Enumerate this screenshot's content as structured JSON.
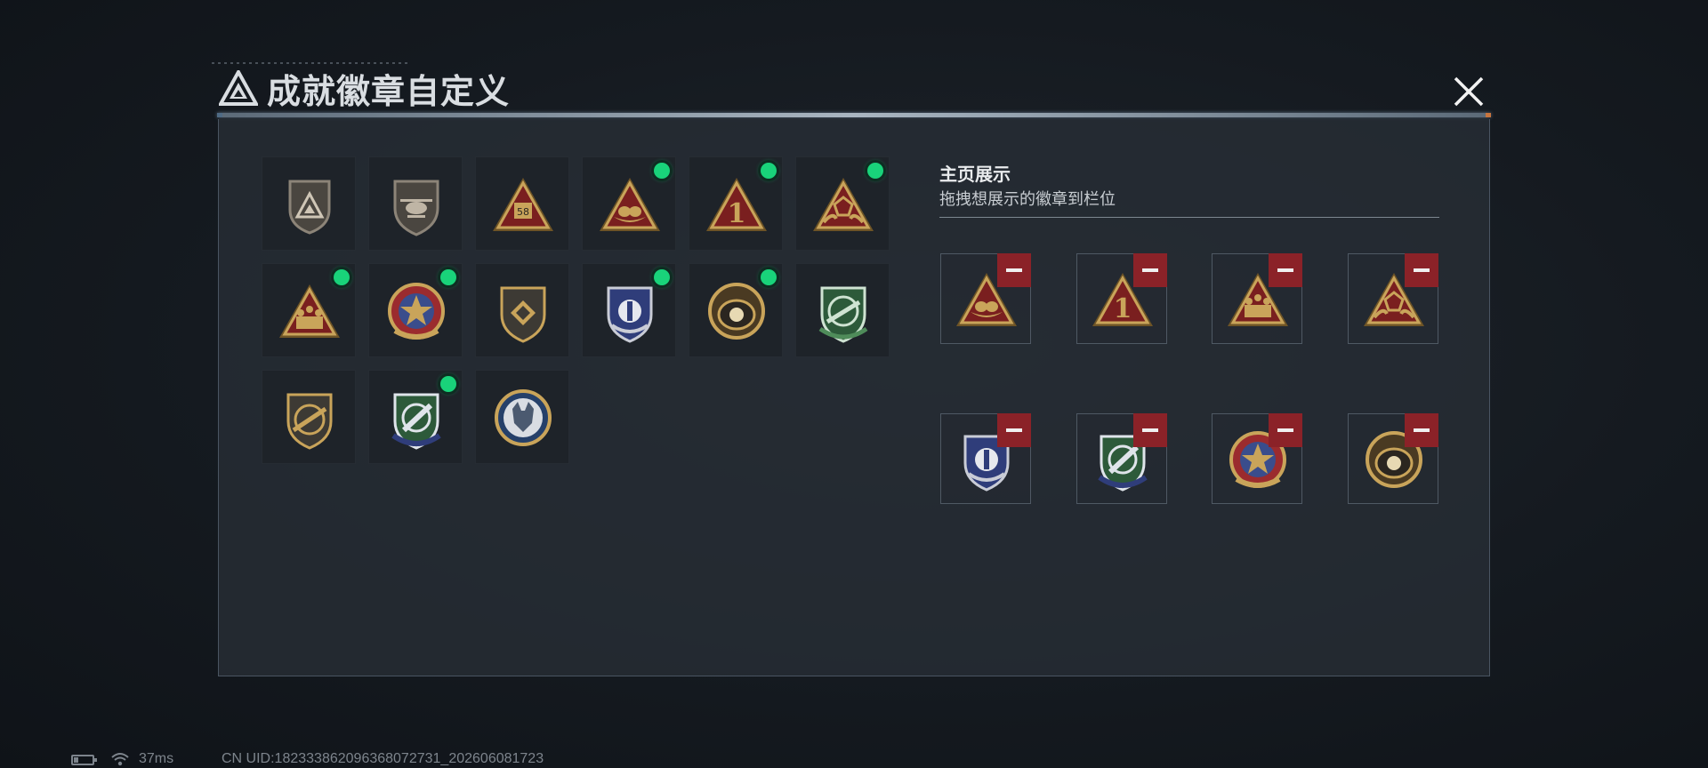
{
  "header": {
    "title": "成就徽章自定义",
    "logo_icon": "triangle-emblem-icon",
    "close_icon": "close-icon"
  },
  "collection": {
    "badges": [
      {
        "icon": "triangle-shield-badge-icon",
        "new": false
      },
      {
        "icon": "helicopter-badge-icon",
        "new": false
      },
      {
        "icon": "pyramid-58-badge-icon",
        "new": false
      },
      {
        "icon": "nest-egg-badge-icon",
        "new": true
      },
      {
        "icon": "number-one-badge-icon",
        "new": true
      },
      {
        "icon": "hands-dice-badge-icon",
        "new": true
      },
      {
        "icon": "squad-badge-icon",
        "new": true
      },
      {
        "icon": "star-medal-badge-icon",
        "new": true
      },
      {
        "icon": "diamond-shield-badge-icon",
        "new": false
      },
      {
        "icon": "blue-wings-shield-badge-icon",
        "new": true
      },
      {
        "icon": "pearl-shell-badge-icon",
        "new": true
      },
      {
        "icon": "green-crosshair-rifle-badge-icon",
        "new": false
      },
      {
        "icon": "rifle-shield-badge-icon",
        "new": false
      },
      {
        "icon": "knife-crosshair-badge-icon",
        "new": true
      },
      {
        "icon": "wolf-head-badge-icon",
        "new": false
      }
    ]
  },
  "display": {
    "title": "主页展示",
    "subtitle": "拖拽想展示的徽章到栏位",
    "slots": [
      {
        "icon": "nest-egg-badge-icon"
      },
      {
        "icon": "number-one-badge-icon"
      },
      {
        "icon": "squad-badge-icon"
      },
      {
        "icon": "hands-dice-badge-icon"
      },
      {
        "icon": "blue-wings-shield-badge-icon"
      },
      {
        "icon": "knife-crosshair-badge-icon"
      },
      {
        "icon": "star-medal-badge-icon"
      },
      {
        "icon": "pearl-shell-badge-icon"
      }
    ]
  },
  "status_bar": {
    "ping": "37ms",
    "uid": "CN UID:1823338620963680727​31_202606081723"
  },
  "colors": {
    "accent_green": "#19d37a",
    "remove_red": "#8b2228",
    "gold": "#c9a45a"
  }
}
